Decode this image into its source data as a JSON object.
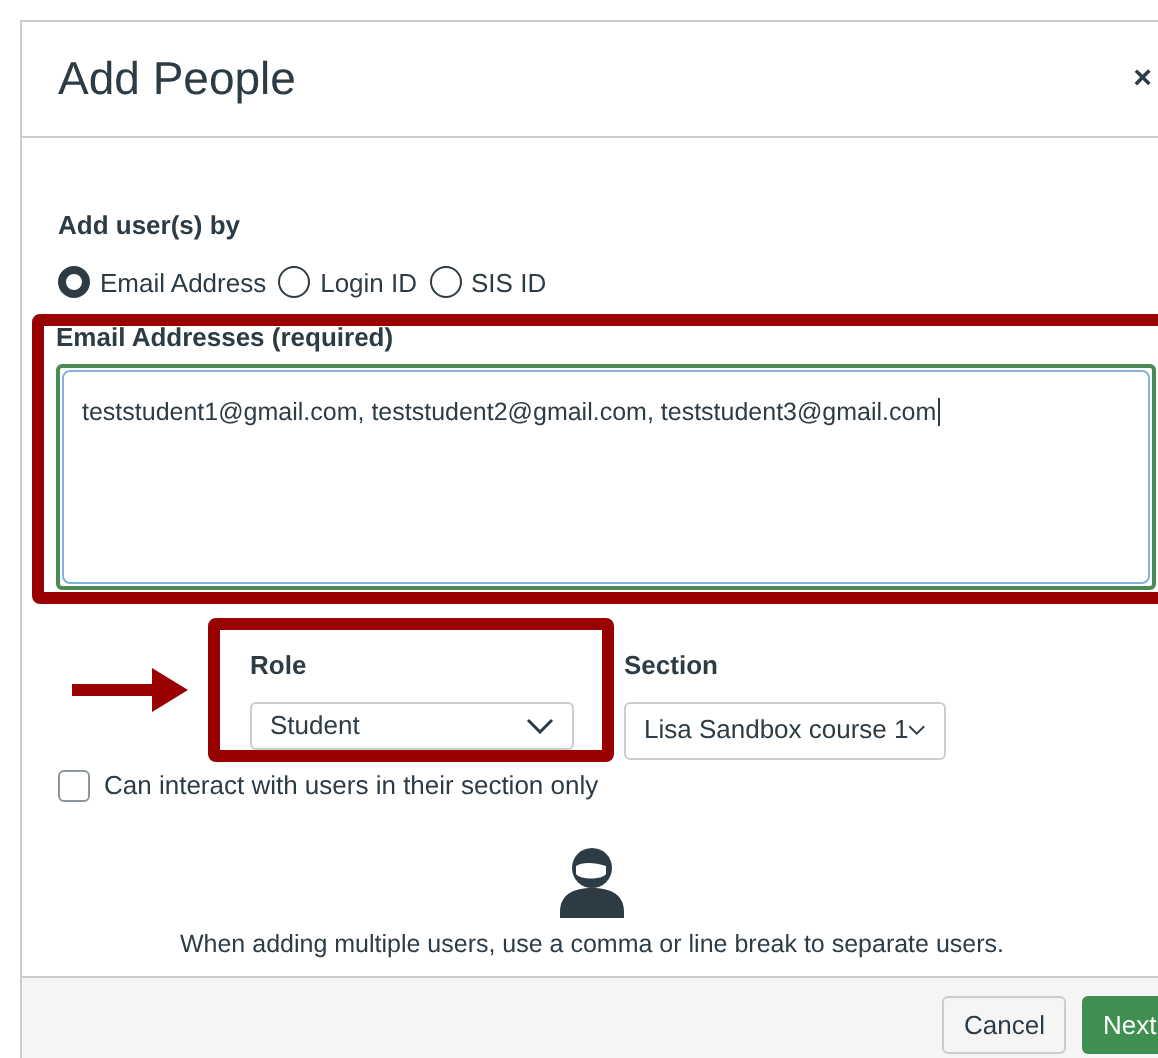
{
  "dialog": {
    "title": "Add People",
    "close": "×"
  },
  "add_by": {
    "label": "Add user(s) by",
    "options": [
      {
        "label": "Email Address",
        "selected": true
      },
      {
        "label": "Login ID",
        "selected": false
      },
      {
        "label": "SIS ID",
        "selected": false
      }
    ]
  },
  "emails": {
    "label": "Email Addresses (required)",
    "value": "teststudent1@gmail.com, teststudent2@gmail.com, teststudent3@gmail.com",
    "highlighted": true
  },
  "role": {
    "label": "Role",
    "value": "Student",
    "highlighted": true
  },
  "section": {
    "label": "Section",
    "value": "Lisa Sandbox course 1"
  },
  "limit_checkbox": {
    "label": "Can interact with users in their section only",
    "checked": false
  },
  "hint": "When adding multiple users, use a comma or line break to separate users.",
  "buttons": [
    {
      "label": "Cancel",
      "kind": "secondary"
    },
    {
      "label": "Next",
      "kind": "primary"
    }
  ]
}
